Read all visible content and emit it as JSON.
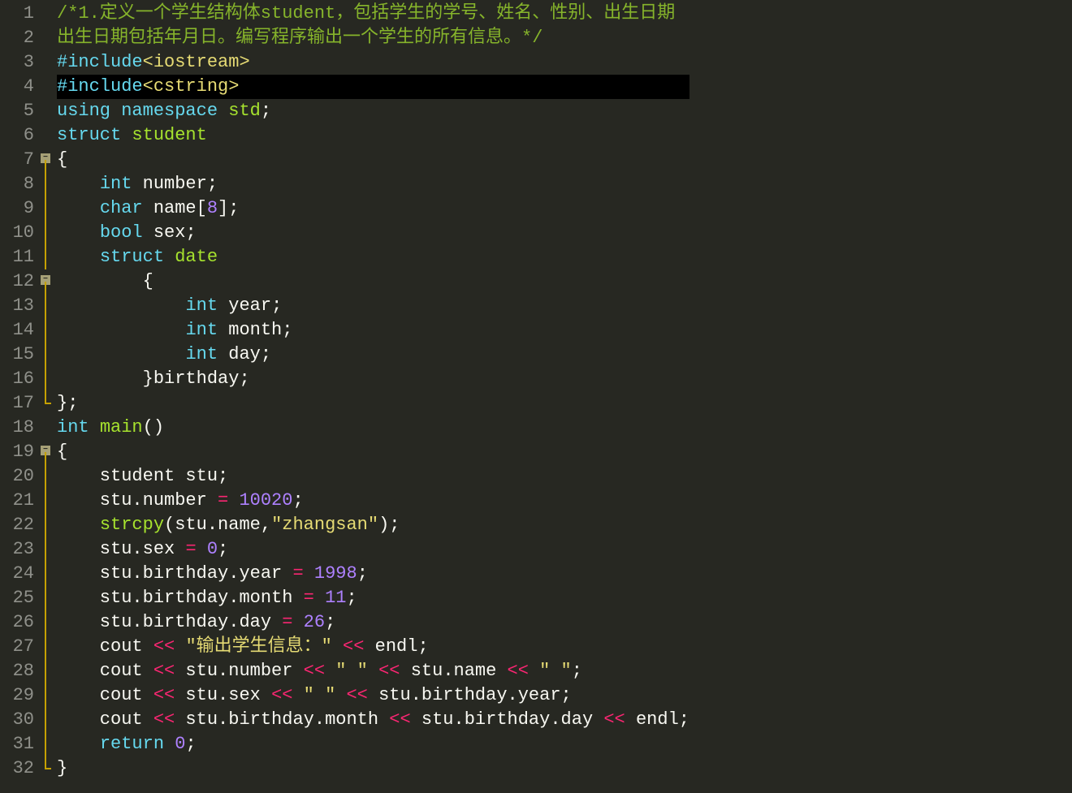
{
  "lines": [
    {
      "n": 1,
      "fold": null,
      "tokens": [
        {
          "cls": "c-comment",
          "t": "/*1.定义一个学生结构体student，包括学生的学号、姓名、性别、出生日期"
        }
      ]
    },
    {
      "n": 2,
      "fold": null,
      "tokens": [
        {
          "cls": "c-comment",
          "t": "出生日期包括年月日。编写程序输出一个学生的所有信息。*/"
        }
      ]
    },
    {
      "n": 3,
      "fold": null,
      "tokens": [
        {
          "cls": "c-preproc",
          "t": "#include"
        },
        {
          "cls": "c-yellow",
          "t": "<iostream>"
        }
      ]
    },
    {
      "n": 4,
      "fold": null,
      "current": true,
      "tokens": [
        {
          "cls": "c-preproc",
          "t": "#include"
        },
        {
          "cls": "c-yellow",
          "t": "<cstring>"
        }
      ]
    },
    {
      "n": 5,
      "fold": null,
      "tokens": [
        {
          "cls": "c-kw2",
          "t": "using"
        },
        {
          "cls": "c-ident",
          "t": " "
        },
        {
          "cls": "c-kw2",
          "t": "namespace"
        },
        {
          "cls": "c-ident",
          "t": " "
        },
        {
          "cls": "c-type",
          "t": "std"
        },
        {
          "cls": "c-punct",
          "t": ";"
        }
      ]
    },
    {
      "n": 6,
      "fold": null,
      "tokens": [
        {
          "cls": "c-kw2",
          "t": "struct"
        },
        {
          "cls": "c-ident",
          "t": " "
        },
        {
          "cls": "c-type",
          "t": "student"
        }
      ]
    },
    {
      "n": 7,
      "fold": "open-top",
      "tokens": [
        {
          "cls": "c-brace",
          "t": "{"
        }
      ]
    },
    {
      "n": 8,
      "fold": "line",
      "tokens": [
        {
          "cls": "c-ident",
          "t": "    "
        },
        {
          "cls": "c-kw2",
          "t": "int"
        },
        {
          "cls": "c-ident",
          "t": " number"
        },
        {
          "cls": "c-punct",
          "t": ";"
        }
      ]
    },
    {
      "n": 9,
      "fold": "line",
      "tokens": [
        {
          "cls": "c-ident",
          "t": "    "
        },
        {
          "cls": "c-kw2",
          "t": "char"
        },
        {
          "cls": "c-ident",
          "t": " name"
        },
        {
          "cls": "c-punct",
          "t": "["
        },
        {
          "cls": "c-number",
          "t": "8"
        },
        {
          "cls": "c-punct",
          "t": "]"
        },
        {
          "cls": "c-punct",
          "t": ";"
        }
      ]
    },
    {
      "n": 10,
      "fold": "line",
      "tokens": [
        {
          "cls": "c-ident",
          "t": "    "
        },
        {
          "cls": "c-kw2",
          "t": "bool"
        },
        {
          "cls": "c-ident",
          "t": " sex"
        },
        {
          "cls": "c-punct",
          "t": ";"
        }
      ]
    },
    {
      "n": 11,
      "fold": "line",
      "tokens": [
        {
          "cls": "c-ident",
          "t": "    "
        },
        {
          "cls": "c-kw2",
          "t": "struct"
        },
        {
          "cls": "c-ident",
          "t": " "
        },
        {
          "cls": "c-type",
          "t": "date"
        }
      ]
    },
    {
      "n": 12,
      "fold": "open",
      "tokens": [
        {
          "cls": "c-ident",
          "t": "        "
        },
        {
          "cls": "c-brace",
          "t": "{"
        }
      ]
    },
    {
      "n": 13,
      "fold": "line",
      "tokens": [
        {
          "cls": "c-ident",
          "t": "            "
        },
        {
          "cls": "c-kw2",
          "t": "int"
        },
        {
          "cls": "c-ident",
          "t": " year"
        },
        {
          "cls": "c-punct",
          "t": ";"
        }
      ]
    },
    {
      "n": 14,
      "fold": "line",
      "tokens": [
        {
          "cls": "c-ident",
          "t": "            "
        },
        {
          "cls": "c-kw2",
          "t": "int"
        },
        {
          "cls": "c-ident",
          "t": " month"
        },
        {
          "cls": "c-punct",
          "t": ";"
        }
      ]
    },
    {
      "n": 15,
      "fold": "line",
      "tokens": [
        {
          "cls": "c-ident",
          "t": "            "
        },
        {
          "cls": "c-kw2",
          "t": "int"
        },
        {
          "cls": "c-ident",
          "t": " day"
        },
        {
          "cls": "c-punct",
          "t": ";"
        }
      ]
    },
    {
      "n": 16,
      "fold": "line",
      "tokens": [
        {
          "cls": "c-ident",
          "t": "        "
        },
        {
          "cls": "c-brace",
          "t": "}"
        },
        {
          "cls": "c-ident",
          "t": "birthday"
        },
        {
          "cls": "c-punct",
          "t": ";"
        }
      ]
    },
    {
      "n": 17,
      "fold": "end",
      "tokens": [
        {
          "cls": "c-brace",
          "t": "}"
        },
        {
          "cls": "c-punct",
          "t": ";"
        }
      ]
    },
    {
      "n": 18,
      "fold": null,
      "tokens": [
        {
          "cls": "c-kw2",
          "t": "int"
        },
        {
          "cls": "c-ident",
          "t": " "
        },
        {
          "cls": "c-func",
          "t": "main"
        },
        {
          "cls": "c-punct",
          "t": "()"
        }
      ]
    },
    {
      "n": 19,
      "fold": "open-top",
      "tokens": [
        {
          "cls": "c-brace",
          "t": "{"
        }
      ]
    },
    {
      "n": 20,
      "fold": "line",
      "tokens": [
        {
          "cls": "c-ident",
          "t": "    student stu"
        },
        {
          "cls": "c-punct",
          "t": ";"
        }
      ]
    },
    {
      "n": 21,
      "fold": "line",
      "tokens": [
        {
          "cls": "c-ident",
          "t": "    stu"
        },
        {
          "cls": "c-punct",
          "t": "."
        },
        {
          "cls": "c-ident",
          "t": "number "
        },
        {
          "cls": "c-op",
          "t": "="
        },
        {
          "cls": "c-ident",
          "t": " "
        },
        {
          "cls": "c-number",
          "t": "10020"
        },
        {
          "cls": "c-punct",
          "t": ";"
        }
      ]
    },
    {
      "n": 22,
      "fold": "line",
      "tokens": [
        {
          "cls": "c-ident",
          "t": "    "
        },
        {
          "cls": "c-func",
          "t": "strcpy"
        },
        {
          "cls": "c-punct",
          "t": "("
        },
        {
          "cls": "c-ident",
          "t": "stu"
        },
        {
          "cls": "c-punct",
          "t": "."
        },
        {
          "cls": "c-ident",
          "t": "name"
        },
        {
          "cls": "c-punct",
          "t": ","
        },
        {
          "cls": "c-string",
          "t": "\"zhangsan\""
        },
        {
          "cls": "c-punct",
          "t": ")"
        },
        {
          "cls": "c-punct",
          "t": ";"
        }
      ]
    },
    {
      "n": 23,
      "fold": "line",
      "tokens": [
        {
          "cls": "c-ident",
          "t": "    stu"
        },
        {
          "cls": "c-punct",
          "t": "."
        },
        {
          "cls": "c-ident",
          "t": "sex "
        },
        {
          "cls": "c-op",
          "t": "="
        },
        {
          "cls": "c-ident",
          "t": " "
        },
        {
          "cls": "c-number",
          "t": "0"
        },
        {
          "cls": "c-punct",
          "t": ";"
        }
      ]
    },
    {
      "n": 24,
      "fold": "line",
      "tokens": [
        {
          "cls": "c-ident",
          "t": "    stu"
        },
        {
          "cls": "c-punct",
          "t": "."
        },
        {
          "cls": "c-ident",
          "t": "birthday"
        },
        {
          "cls": "c-punct",
          "t": "."
        },
        {
          "cls": "c-ident",
          "t": "year "
        },
        {
          "cls": "c-op",
          "t": "="
        },
        {
          "cls": "c-ident",
          "t": " "
        },
        {
          "cls": "c-number",
          "t": "1998"
        },
        {
          "cls": "c-punct",
          "t": ";"
        }
      ]
    },
    {
      "n": 25,
      "fold": "line",
      "tokens": [
        {
          "cls": "c-ident",
          "t": "    stu"
        },
        {
          "cls": "c-punct",
          "t": "."
        },
        {
          "cls": "c-ident",
          "t": "birthday"
        },
        {
          "cls": "c-punct",
          "t": "."
        },
        {
          "cls": "c-ident",
          "t": "month "
        },
        {
          "cls": "c-op",
          "t": "="
        },
        {
          "cls": "c-ident",
          "t": " "
        },
        {
          "cls": "c-number",
          "t": "11"
        },
        {
          "cls": "c-punct",
          "t": ";"
        }
      ]
    },
    {
      "n": 26,
      "fold": "line",
      "tokens": [
        {
          "cls": "c-ident",
          "t": "    stu"
        },
        {
          "cls": "c-punct",
          "t": "."
        },
        {
          "cls": "c-ident",
          "t": "birthday"
        },
        {
          "cls": "c-punct",
          "t": "."
        },
        {
          "cls": "c-ident",
          "t": "day "
        },
        {
          "cls": "c-op",
          "t": "="
        },
        {
          "cls": "c-ident",
          "t": " "
        },
        {
          "cls": "c-number",
          "t": "26"
        },
        {
          "cls": "c-punct",
          "t": ";"
        }
      ]
    },
    {
      "n": 27,
      "fold": "line",
      "tokens": [
        {
          "cls": "c-ident",
          "t": "    cout "
        },
        {
          "cls": "c-op",
          "t": "<<"
        },
        {
          "cls": "c-ident",
          "t": " "
        },
        {
          "cls": "c-string",
          "t": "\"输出学生信息：\""
        },
        {
          "cls": "c-ident",
          "t": " "
        },
        {
          "cls": "c-op",
          "t": "<<"
        },
        {
          "cls": "c-ident",
          "t": " endl"
        },
        {
          "cls": "c-punct",
          "t": ";"
        }
      ]
    },
    {
      "n": 28,
      "fold": "line",
      "tokens": [
        {
          "cls": "c-ident",
          "t": "    cout "
        },
        {
          "cls": "c-op",
          "t": "<<"
        },
        {
          "cls": "c-ident",
          "t": " stu"
        },
        {
          "cls": "c-punct",
          "t": "."
        },
        {
          "cls": "c-ident",
          "t": "number "
        },
        {
          "cls": "c-op",
          "t": "<<"
        },
        {
          "cls": "c-ident",
          "t": " "
        },
        {
          "cls": "c-string",
          "t": "\" \""
        },
        {
          "cls": "c-ident",
          "t": " "
        },
        {
          "cls": "c-op",
          "t": "<<"
        },
        {
          "cls": "c-ident",
          "t": " stu"
        },
        {
          "cls": "c-punct",
          "t": "."
        },
        {
          "cls": "c-ident",
          "t": "name "
        },
        {
          "cls": "c-op",
          "t": "<<"
        },
        {
          "cls": "c-ident",
          "t": " "
        },
        {
          "cls": "c-string",
          "t": "\" \""
        },
        {
          "cls": "c-punct",
          "t": ";"
        }
      ]
    },
    {
      "n": 29,
      "fold": "line",
      "tokens": [
        {
          "cls": "c-ident",
          "t": "    cout "
        },
        {
          "cls": "c-op",
          "t": "<<"
        },
        {
          "cls": "c-ident",
          "t": " stu"
        },
        {
          "cls": "c-punct",
          "t": "."
        },
        {
          "cls": "c-ident",
          "t": "sex "
        },
        {
          "cls": "c-op",
          "t": "<<"
        },
        {
          "cls": "c-ident",
          "t": " "
        },
        {
          "cls": "c-string",
          "t": "\" \""
        },
        {
          "cls": "c-ident",
          "t": " "
        },
        {
          "cls": "c-op",
          "t": "<<"
        },
        {
          "cls": "c-ident",
          "t": " stu"
        },
        {
          "cls": "c-punct",
          "t": "."
        },
        {
          "cls": "c-ident",
          "t": "birthday"
        },
        {
          "cls": "c-punct",
          "t": "."
        },
        {
          "cls": "c-ident",
          "t": "year"
        },
        {
          "cls": "c-punct",
          "t": ";"
        }
      ]
    },
    {
      "n": 30,
      "fold": "line",
      "tokens": [
        {
          "cls": "c-ident",
          "t": "    cout "
        },
        {
          "cls": "c-op",
          "t": "<<"
        },
        {
          "cls": "c-ident",
          "t": " stu"
        },
        {
          "cls": "c-punct",
          "t": "."
        },
        {
          "cls": "c-ident",
          "t": "birthday"
        },
        {
          "cls": "c-punct",
          "t": "."
        },
        {
          "cls": "c-ident",
          "t": "month "
        },
        {
          "cls": "c-op",
          "t": "<<"
        },
        {
          "cls": "c-ident",
          "t": " stu"
        },
        {
          "cls": "c-punct",
          "t": "."
        },
        {
          "cls": "c-ident",
          "t": "birthday"
        },
        {
          "cls": "c-punct",
          "t": "."
        },
        {
          "cls": "c-ident",
          "t": "day "
        },
        {
          "cls": "c-op",
          "t": "<<"
        },
        {
          "cls": "c-ident",
          "t": " endl"
        },
        {
          "cls": "c-punct",
          "t": ";"
        }
      ]
    },
    {
      "n": 31,
      "fold": "line",
      "tokens": [
        {
          "cls": "c-ident",
          "t": "    "
        },
        {
          "cls": "c-kw2",
          "t": "return"
        },
        {
          "cls": "c-ident",
          "t": " "
        },
        {
          "cls": "c-number",
          "t": "0"
        },
        {
          "cls": "c-punct",
          "t": ";"
        }
      ]
    },
    {
      "n": 32,
      "fold": "end",
      "tokens": [
        {
          "cls": "c-brace",
          "t": "}"
        }
      ]
    }
  ]
}
